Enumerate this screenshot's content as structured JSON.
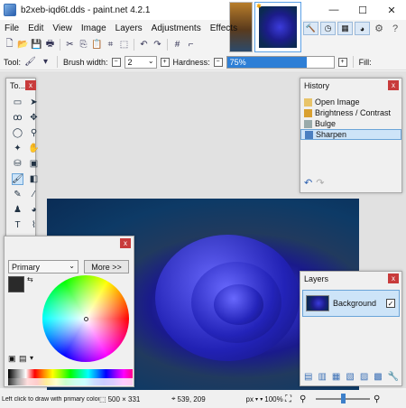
{
  "window": {
    "title": "b2xeb-iqd6t.dds - paint.net 4.2.1",
    "minimize_glyph": "—",
    "maximize_glyph": "☐",
    "close_glyph": "✕"
  },
  "menu": [
    "File",
    "Edit",
    "View",
    "Image",
    "Layers",
    "Adjustments",
    "Effects"
  ],
  "toolbar_options": {
    "tool_label": "Tool:",
    "brush_width_label": "Brush width:",
    "brush_width_value": "2",
    "hardness_label": "Hardness:",
    "hardness_value": "75%",
    "hardness_fraction": 0.75,
    "fill_label": "Fill:"
  },
  "tools_panel": {
    "title": "To...",
    "close": "x",
    "icons": [
      "rectangle-select-icon",
      "move-selection-icon",
      "lasso-select-icon",
      "move-selected-icon",
      "ellipse-select-icon",
      "zoom-icon",
      "magic-wand-icon",
      "pan-icon",
      "paint-bucket-icon",
      "gradient-icon",
      "paintbrush-icon",
      "eraser-icon",
      "pencil-icon",
      "color-picker-icon",
      "clone-stamp-icon",
      "recolor-icon",
      "text-icon",
      "line-curve-icon",
      "shapes-icon"
    ]
  },
  "history_panel": {
    "title": "History",
    "close": "x",
    "items": [
      {
        "label": "Open Image",
        "selected": false
      },
      {
        "label": "Brightness / Contrast",
        "selected": false
      },
      {
        "label": "Bulge",
        "selected": false
      },
      {
        "label": "Sharpen",
        "selected": true
      }
    ],
    "undo_glyph": "↶",
    "redo_glyph": "↷"
  },
  "colors_panel": {
    "close": "x",
    "mode": "Primary",
    "more_button": "More >>",
    "primary_color": "#2a2a2a",
    "secondary_color": "#ffffff"
  },
  "layers_panel": {
    "title": "Layers",
    "close": "x",
    "layers": [
      {
        "name": "Background",
        "visible": true
      }
    ]
  },
  "statusbar": {
    "hint": "Left click to draw with primary color, right cli...",
    "image_size": "500 × 331",
    "cursor_pos": "539, 209",
    "units": "px",
    "zoom": "100%"
  },
  "colors": {
    "accent": "#2e7fd6",
    "selection": "#cde4f8",
    "close_red": "#c83b3b"
  }
}
